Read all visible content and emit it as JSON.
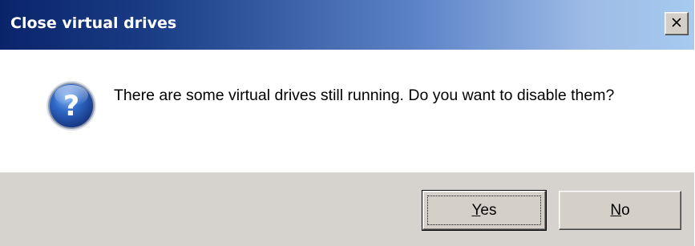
{
  "dialog": {
    "title": "Close virtual drives",
    "close_icon": "close-icon",
    "message": "There are some virtual drives still running. Do you want to disable them?",
    "icon": "question-icon",
    "buttons": {
      "yes": {
        "mnemonic": "Y",
        "rest": "es"
      },
      "no": {
        "mnemonic": "N",
        "rest": "o"
      }
    },
    "colors": {
      "titlebar_start": "#0a246a",
      "titlebar_end": "#a6caf0",
      "footer": "#d6d3ce",
      "icon_blue": "#2a5bb5"
    }
  }
}
